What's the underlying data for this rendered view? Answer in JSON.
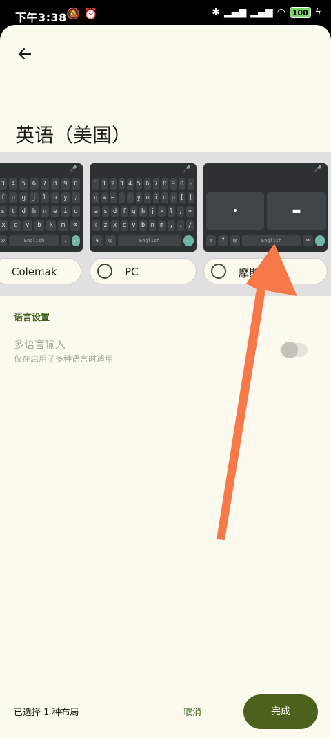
{
  "status_bar": {
    "time": "下午3:38",
    "battery": "100"
  },
  "page": {
    "title": "英语（美国）"
  },
  "layouts": [
    {
      "label": "Colemak"
    },
    {
      "label": "PC"
    },
    {
      "label": "摩斯"
    }
  ],
  "keyboard_preview": {
    "space_label": "English"
  },
  "language_section": {
    "header": "语言设置",
    "multilang_title": "多语言输入",
    "multilang_sub": "仅在启用了多种语言时适用",
    "multilang_enabled": false
  },
  "footer": {
    "selected_text": "已选择 1 种布局",
    "cancel_label": "取消",
    "done_label": "完成"
  },
  "colors": {
    "accent": "#4c621c",
    "background": "#fcf9ef",
    "annotation_arrow": "#f7794a"
  }
}
